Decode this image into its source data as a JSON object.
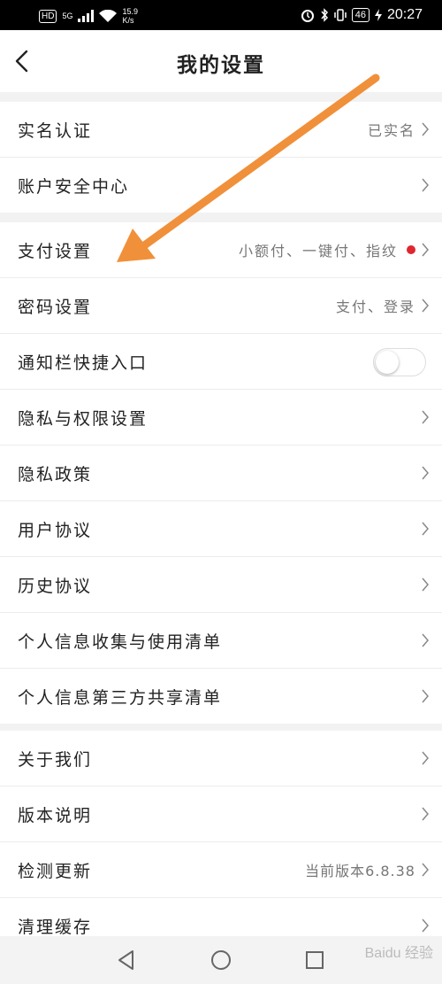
{
  "status_bar": {
    "hd": "HD",
    "network": "5G",
    "speed_value": "15.9",
    "speed_unit": "K/s",
    "battery": "46",
    "time": "20:27"
  },
  "header": {
    "title": "我的设置"
  },
  "sections": [
    {
      "items": [
        {
          "label": "实名认证",
          "value": "已实名"
        },
        {
          "label": "账户安全中心",
          "value": ""
        }
      ]
    },
    {
      "items": [
        {
          "label": "支付设置",
          "value": "小额付、一键付、指纹"
        },
        {
          "label": "密码设置",
          "value": "支付、登录"
        },
        {
          "label": "通知栏快捷入口",
          "toggle_on": false
        },
        {
          "label": "隐私与权限设置",
          "value": ""
        },
        {
          "label": "隐私政策",
          "value": ""
        },
        {
          "label": "用户协议",
          "value": ""
        },
        {
          "label": "历史协议",
          "value": ""
        },
        {
          "label": "个人信息收集与使用清单",
          "value": ""
        },
        {
          "label": "个人信息第三方共享清单",
          "value": ""
        }
      ]
    },
    {
      "items": [
        {
          "label": "关于我们",
          "value": ""
        },
        {
          "label": "版本说明",
          "value": ""
        },
        {
          "label": "检测更新",
          "value": "当前版本6.8.38"
        },
        {
          "label": "清理缓存",
          "value": ""
        }
      ]
    }
  ],
  "watermark": "Baidu 经验",
  "colors": {
    "accent_arrow": "#f0903a",
    "badge_dot": "#e0262f"
  }
}
